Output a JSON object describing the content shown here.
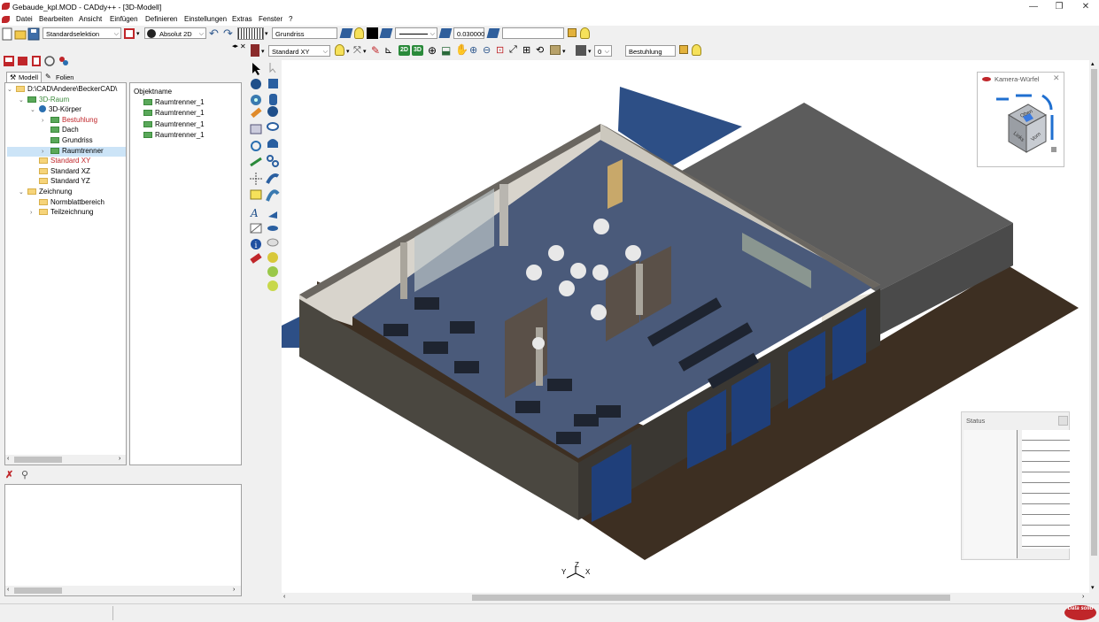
{
  "window": {
    "title": "Gebaude_kpl.MOD  -  CADdy++ - [3D-Modell]",
    "minimize": "—",
    "maximize": "❐",
    "close": "✕"
  },
  "menu": [
    "Datei",
    "Bearbeiten",
    "Ansicht",
    "Einfügen",
    "Definieren",
    "Einstellungen",
    "Extras",
    "Fenster",
    "?"
  ],
  "toolbar1": {
    "selection_mode": "Standardselektion",
    "coord_mode": "Absolut 2D",
    "layer": "Grundriss",
    "line_width": "0.030000",
    "color_swatch": "#000000"
  },
  "toolbar2": {
    "view": "Standard XY",
    "btn_2d": "2D",
    "btn_3d": "3D",
    "value": "0",
    "group": "Bestuhlung"
  },
  "left_panel": {
    "tabs": [
      {
        "label": "Modell"
      },
      {
        "label": "Folien"
      }
    ],
    "tree": [
      {
        "label": "D:\\CAD\\Andere\\BeckerCAD\\",
        "indent": 0,
        "expander": "v",
        "icon": "drive",
        "color": "normal"
      },
      {
        "label": "3D-Raum",
        "indent": 1,
        "expander": "v",
        "icon": "gfolder",
        "color": "green"
      },
      {
        "label": "3D-Körper",
        "indent": 2,
        "expander": "v",
        "icon": "globe",
        "color": "normal"
      },
      {
        "label": "Bestuhlung",
        "indent": 3,
        "expander": ">",
        "icon": "gfolder",
        "color": "red"
      },
      {
        "label": "Dach",
        "indent": 3,
        "expander": "",
        "icon": "gfolder",
        "color": "normal"
      },
      {
        "label": "Grundriss",
        "indent": 3,
        "expander": "",
        "icon": "gfolder",
        "color": "normal"
      },
      {
        "label": "Raumtrenner",
        "indent": 3,
        "expander": ">",
        "icon": "gfolder",
        "color": "normal",
        "selected": true
      },
      {
        "label": "Standard XY",
        "indent": 2,
        "expander": "",
        "icon": "folder",
        "color": "red"
      },
      {
        "label": "Standard XZ",
        "indent": 2,
        "expander": "",
        "icon": "folder",
        "color": "normal"
      },
      {
        "label": "Standard YZ",
        "indent": 2,
        "expander": "",
        "icon": "folder",
        "color": "normal"
      },
      {
        "label": "Zeichnung",
        "indent": 1,
        "expander": "v",
        "icon": "folder",
        "color": "normal"
      },
      {
        "label": "Normblattbereich",
        "indent": 2,
        "expander": "",
        "icon": "folder",
        "color": "normal"
      },
      {
        "label": "Teilzeichnung",
        "indent": 2,
        "expander": ">",
        "icon": "folder",
        "color": "normal"
      }
    ],
    "object_list": {
      "header": "Objektname",
      "items": [
        "Raumtrenner_1",
        "Raumtrenner_1",
        "Raumtrenner_1",
        "Raumtrenner_1"
      ]
    }
  },
  "camera_cube": {
    "title": "Kamera-Würfel",
    "faces": [
      "Oben",
      "Links",
      "Vorn"
    ]
  },
  "status_panel": {
    "title": "Status"
  },
  "axis_labels": {
    "z": "Z",
    "y": "Y",
    "x": "X"
  },
  "brand": "Data solid",
  "colors": {
    "floor": "#4a5a7a",
    "terrace": "#3d2f22",
    "roof": "#5c5c5c",
    "wall": "#d8d4cc",
    "wall_dark": "#4a4740",
    "water": "#2d4f86",
    "accent_red": "#c0262a"
  }
}
